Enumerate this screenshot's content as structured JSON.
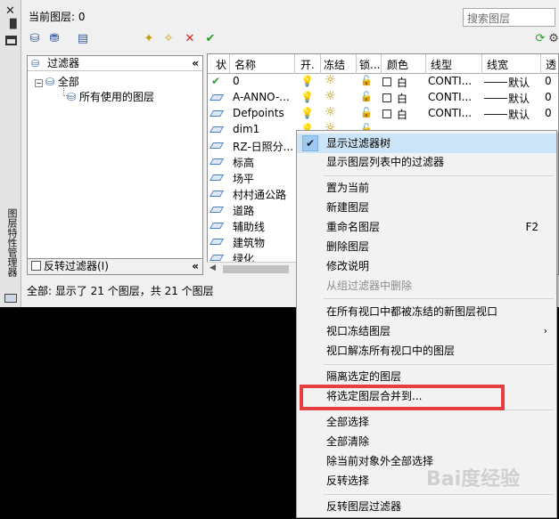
{
  "window": {
    "title_vertical": "图层特性管理器",
    "current_layer_label": "当前图层: 0",
    "search_placeholder": "搜索图层"
  },
  "filter_panel": {
    "header": "过滤器",
    "tree_root": "全部",
    "tree_child": "所有使用的图层",
    "invert_label": "反转过滤器(I)"
  },
  "layer_table": {
    "columns": [
      "状",
      "名称",
      "开.",
      "冻结",
      "锁...",
      "颜色",
      "线型",
      "线宽",
      "透"
    ],
    "rows": [
      {
        "name": "0",
        "color": "白",
        "linetype": "CONTI...",
        "lineweight": "默认",
        "trans": "0",
        "current": true
      },
      {
        "name": "A-ANNO-...",
        "color": "白",
        "linetype": "CONTI...",
        "lineweight": "默认",
        "trans": "0",
        "current": false
      },
      {
        "name": "Defpoints",
        "color": "白",
        "linetype": "CONTI...",
        "lineweight": "默认",
        "trans": "0",
        "current": false
      },
      {
        "name": "dim1",
        "color": "",
        "linetype": "",
        "lineweight": "",
        "trans": "",
        "current": false
      },
      {
        "name": "RZ-日照分...",
        "color": "",
        "linetype": "",
        "lineweight": "",
        "trans": "",
        "current": false
      },
      {
        "name": "标高",
        "color": "",
        "linetype": "",
        "lineweight": "",
        "trans": "",
        "current": false
      },
      {
        "name": "场平",
        "color": "",
        "linetype": "",
        "lineweight": "",
        "trans": "",
        "current": false
      },
      {
        "name": "村村通公路",
        "color": "",
        "linetype": "",
        "lineweight": "",
        "trans": "",
        "current": false
      },
      {
        "name": "道路",
        "color": "",
        "linetype": "",
        "lineweight": "",
        "trans": "",
        "current": false
      },
      {
        "name": "辅助线",
        "color": "",
        "linetype": "",
        "lineweight": "",
        "trans": "",
        "current": false
      },
      {
        "name": "建筑物",
        "color": "",
        "linetype": "",
        "lineweight": "",
        "trans": "",
        "current": false
      },
      {
        "name": "绿化",
        "color": "",
        "linetype": "",
        "lineweight": "",
        "trans": "",
        "current": false
      }
    ]
  },
  "status_text": "全部: 显示了 21 个图层，共 21 个图层",
  "context_menu": {
    "items": [
      {
        "label": "显示过滤器树",
        "checked": true
      },
      {
        "label": "显示图层列表中的过滤器"
      },
      {
        "label": "置为当前"
      },
      {
        "label": "新建图层"
      },
      {
        "label": "重命名图层",
        "shortcut": "F2"
      },
      {
        "label": "删除图层"
      },
      {
        "label": "修改说明"
      },
      {
        "label": "从组过滤器中删除",
        "disabled": true
      },
      {
        "label": "在所有视口中都被冻结的新图层视口"
      },
      {
        "label": "视口冻结图层",
        "submenu": true
      },
      {
        "label": "视口解冻所有视口中的图层"
      },
      {
        "label": "隔离选定的图层"
      },
      {
        "label": "将选定图层合并到..."
      },
      {
        "label": "全部选择"
      },
      {
        "label": "全部清除"
      },
      {
        "label": "除当前对象外全部选择"
      },
      {
        "label": "反转选择"
      },
      {
        "label": "反转图层过滤器"
      }
    ]
  },
  "colors": {
    "highlight_box": "#e73f3f",
    "check_green": "#2a9d2a",
    "delete_red": "#d22222"
  },
  "watermark": "Bai度经验"
}
